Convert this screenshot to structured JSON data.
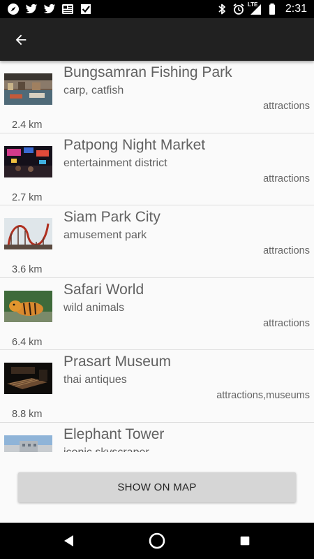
{
  "status_bar": {
    "time": "2:31",
    "network_label": "LTE",
    "notification_icons": [
      "compass-app-icon",
      "twitter-icon",
      "twitter-icon",
      "news-icon",
      "checklist-icon"
    ],
    "system_icons": [
      "bluetooth-icon",
      "alarm-icon",
      "signal-lte-icon",
      "battery-icon"
    ]
  },
  "app_bar": {
    "back_icon": "arrow-back-icon"
  },
  "places": [
    {
      "name": "Bungsamran Fishing Park",
      "description": "carp, catfish",
      "category": "attractions",
      "distance": "2.4 km",
      "image": "fishing-park-photo"
    },
    {
      "name": "Patpong Night Market",
      "description": "entertainment district",
      "category": "attractions",
      "distance": "2.7 km",
      "image": "night-market-photo"
    },
    {
      "name": "Siam Park City",
      "description": "amusement park",
      "category": "attractions",
      "distance": "3.6 km",
      "image": "roller-coaster-photo"
    },
    {
      "name": "Safari World",
      "description": "wild animals",
      "category": "attractions",
      "distance": "6.4 km",
      "image": "tiger-photo"
    },
    {
      "name": "Prasart Museum",
      "description": "thai antiques",
      "category": "attractions,museums",
      "distance": "8.8 km",
      "image": "museum-interior-photo"
    },
    {
      "name": "Elephant Tower",
      "description": "iconic skyscraper",
      "category": "",
      "distance": "",
      "image": "skyscraper-photo"
    }
  ],
  "footer": {
    "show_on_map_label": "SHOW ON MAP"
  },
  "nav_bar": {
    "icons": [
      "nav-back-icon",
      "nav-home-icon",
      "nav-recents-icon"
    ]
  },
  "colors": {
    "status_bar": "#000000",
    "app_bar": "#212121",
    "background": "#fafafa",
    "button": "#d6d6d6",
    "text_primary": "#616161"
  }
}
